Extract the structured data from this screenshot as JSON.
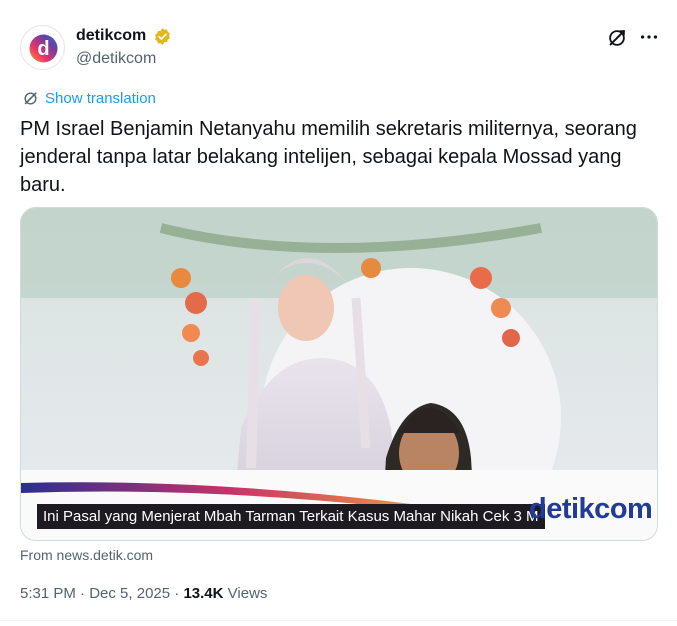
{
  "account": {
    "display_name": "detikcom",
    "handle": "@detikcom",
    "avatar_letter": "d",
    "verified_color": "#e2b719"
  },
  "translate": {
    "label": "Show translation"
  },
  "tweet": {
    "text": "PM Israel Benjamin Netanyahu memilih sekretaris militernya, seorang\njenderal tanpa latar belakang intelijen, sebagai kepala Mossad yang\nbaru."
  },
  "media": {
    "headline": "Ini Pasal yang Menjerat Mbah Tarman Terkait Kasus Mahar Nikah Cek 3 M",
    "brand": "detikcom"
  },
  "card": {
    "source": "From news.detik.com"
  },
  "meta": {
    "time": "5:31 PM",
    "separator": " · ",
    "date": "Dec 5, 2025",
    "views_count": "13.4K",
    "views_label": "Views"
  },
  "colors": {
    "link": "#1d9bf0",
    "secondary_text": "#536471",
    "primary_text": "#0f1419"
  },
  "icons": {
    "grok": "grok-icon",
    "more": "more-icon",
    "translate": "translate-icon",
    "verified": "verified-badge-icon"
  }
}
